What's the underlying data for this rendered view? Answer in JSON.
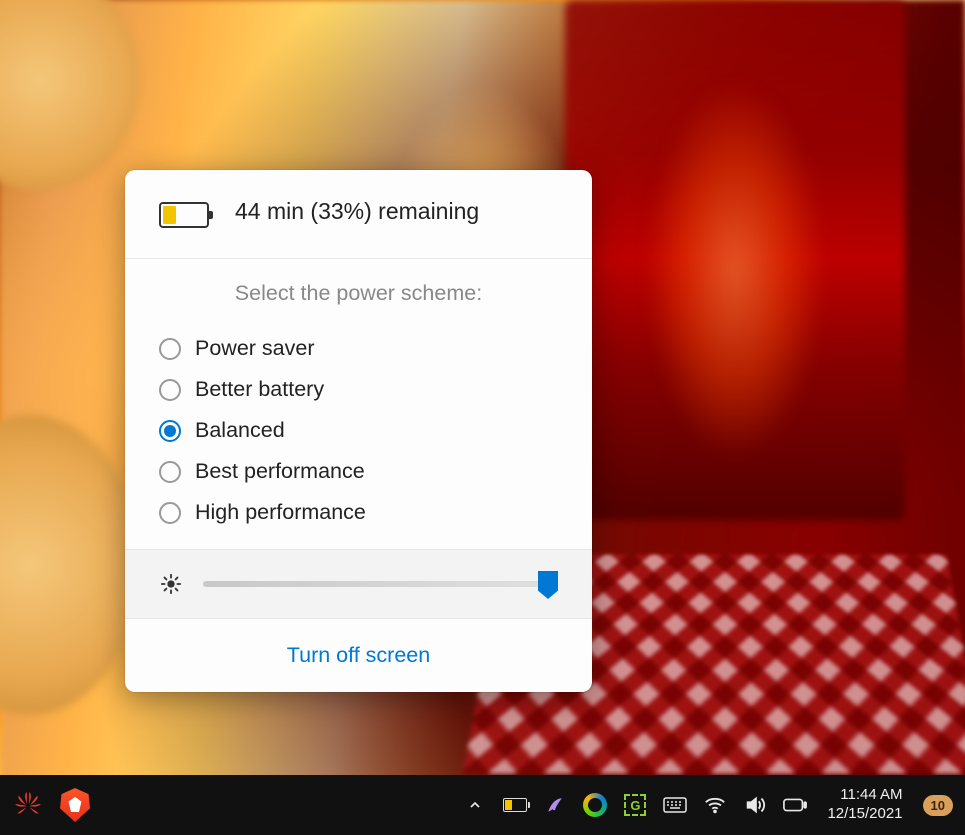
{
  "battery": {
    "status_text": "44 min (33%) remaining",
    "percent": 33
  },
  "scheme": {
    "label": "Select the power scheme:",
    "options": [
      {
        "id": "power-saver",
        "label": "Power saver",
        "selected": false
      },
      {
        "id": "better-battery",
        "label": "Better battery",
        "selected": false
      },
      {
        "id": "balanced",
        "label": "Balanced",
        "selected": true
      },
      {
        "id": "best-performance",
        "label": "Best performance",
        "selected": false
      },
      {
        "id": "high-performance",
        "label": "High performance",
        "selected": false
      }
    ]
  },
  "brightness": {
    "value": 100
  },
  "turn_off_label": "Turn off screen",
  "clock": {
    "time": "11:44 AM",
    "date": "12/15/2021"
  },
  "notifications": {
    "count": "10"
  }
}
